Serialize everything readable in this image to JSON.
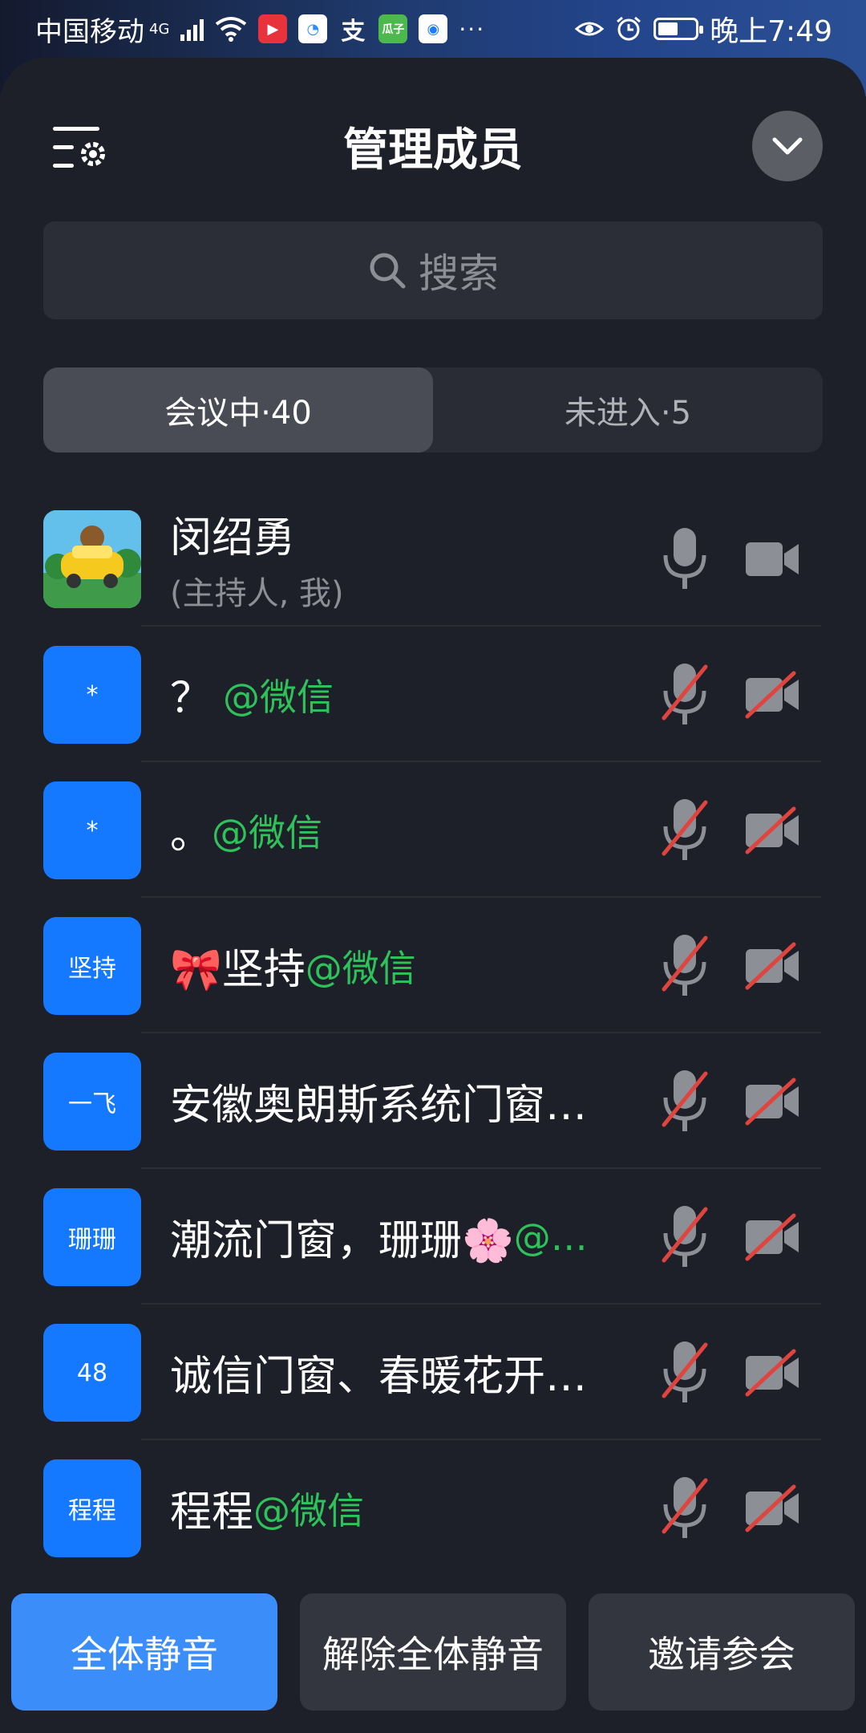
{
  "status_bar": {
    "carrier": "中国移动",
    "network": "4G",
    "time": "晚上7:49",
    "more": "···",
    "app_icons": [
      "video-app-icon",
      "chat-app-icon",
      "alipay-icon",
      "melon-app-icon",
      "blue-app-icon"
    ]
  },
  "header": {
    "title": "管理成员"
  },
  "search": {
    "placeholder": "搜索"
  },
  "tabs": [
    {
      "label": "会议中·40",
      "active": true
    },
    {
      "label": "未进入·5",
      "active": false
    }
  ],
  "members": [
    {
      "avatar": "",
      "name": "闵绍勇",
      "role": "(主持人, 我)",
      "mic": "on",
      "camera": "on"
    },
    {
      "avatar": "*",
      "name": "？",
      "suffix": "@微信",
      "mic": "off",
      "camera": "off"
    },
    {
      "avatar": "*",
      "name": "。",
      "suffix": "@微信",
      "mic": "off",
      "camera": "off"
    },
    {
      "avatar": "坚持",
      "name": "🎀坚持",
      "suffix": "@微信",
      "mic": "off",
      "camera": "off"
    },
    {
      "avatar": "一飞",
      "name": "安徽奥朗斯系统门窗…",
      "suffix": "",
      "mic": "off",
      "camera": "off"
    },
    {
      "avatar": "珊珊",
      "name": "潮流门窗，珊珊🌸",
      "suffix": "@…",
      "mic": "off",
      "camera": "off"
    },
    {
      "avatar": "48",
      "name": "诚信门窗、春暖花开…",
      "suffix": "",
      "mic": "off",
      "camera": "off"
    },
    {
      "avatar": "程程",
      "name": "程程",
      "suffix": "@微信",
      "mic": "off",
      "camera": "off"
    }
  ],
  "actions": {
    "mute_all": "全体静音",
    "unmute_all": "解除全体静音",
    "invite": "邀请参会"
  },
  "colors": {
    "accent": "#3b8dfa",
    "avatar_blue": "#1479ff",
    "wechat_green": "#2ec25b",
    "muted_red": "#e0443e",
    "panel_bg": "#1d1f29"
  }
}
